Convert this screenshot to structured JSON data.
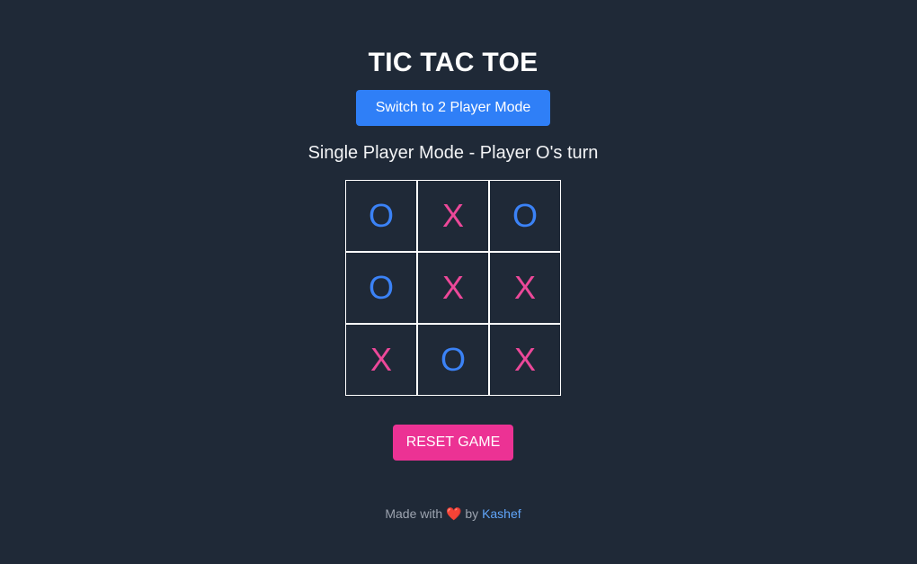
{
  "title": "TIC TAC TOE",
  "mode_button_label": "Switch to 2 Player Mode",
  "status": "Single Player Mode - Player O's turn",
  "board": [
    [
      "O",
      "X",
      "O"
    ],
    [
      "O",
      "X",
      "X"
    ],
    [
      "X",
      "O",
      "X"
    ]
  ],
  "reset_button_label": "RESET GAME",
  "footer": {
    "prefix": "Made with",
    "heart": "❤️",
    "by": "by",
    "author": "Kashef"
  },
  "colors": {
    "background": "#1f2937",
    "x_mark": "#ec4899",
    "o_mark": "#3b82f6",
    "mode_button": "#2f7ff7",
    "reset_button": "#ec3294",
    "author_link": "#60a5fa"
  }
}
